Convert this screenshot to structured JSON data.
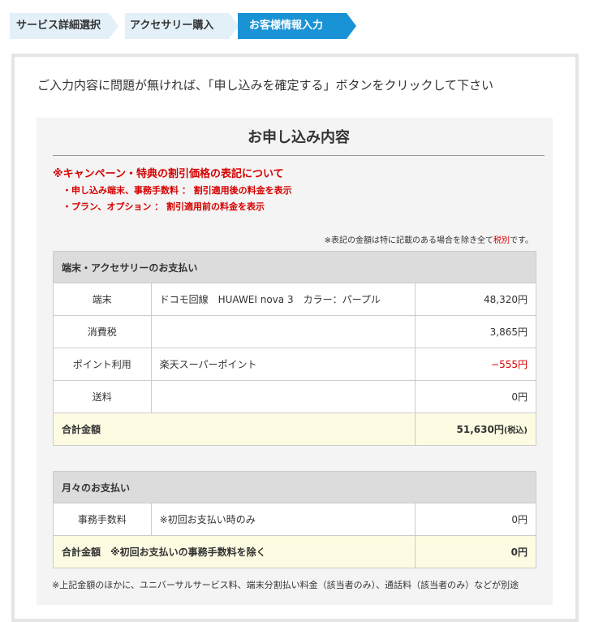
{
  "steps": [
    "サービス詳細選択",
    "アクセサリー購入",
    "お客様情報入力"
  ],
  "intro": "ご入力内容に問題が無ければ、「申し込みを確定する」ボタンをクリックして下さい",
  "panel_title": "お申し込み内容",
  "notice": {
    "heading": "※キャンペーン・特典の割引価格の表記について",
    "items": [
      "・申し込み端末、事務手数料 ： 割引適用後の料金を表示",
      "・プラン、オプション ： 割引適用前の料金を表示"
    ]
  },
  "tax_note": {
    "prefix": "※表記の金額は特に記載のある場合を除き全て",
    "highlight": "税別",
    "suffix": "です。"
  },
  "device_payment": {
    "heading": "端末・アクセサリーのお支払い",
    "rows": [
      {
        "label": "端末",
        "desc": "ドコモ回線　HUAWEI nova 3　カラー：パープル",
        "amount": "48,320円"
      },
      {
        "label": "消費税",
        "desc": "",
        "amount": "3,865円"
      },
      {
        "label": "ポイント利用",
        "desc": "楽天スーパーポイント",
        "amount": "−555円"
      },
      {
        "label": "送料",
        "desc": "",
        "amount": "0円"
      }
    ],
    "total_label": "合計金額",
    "total_amount": "51,630円",
    "total_tax": "(税込)"
  },
  "monthly_payment": {
    "heading": "月々のお支払い",
    "rows": [
      {
        "label": "事務手数料",
        "desc": "※初回お支払い時のみ",
        "amount": "0円"
      }
    ],
    "total_label": "合計金額　※初回お支払いの事務手数料を除く",
    "total_amount": "0円"
  },
  "footnote": "※上記金額のほかに、ユニバーサルサービス料、端末分割払い料金（該当者のみ）、通話料（該当者のみ）などが別途"
}
